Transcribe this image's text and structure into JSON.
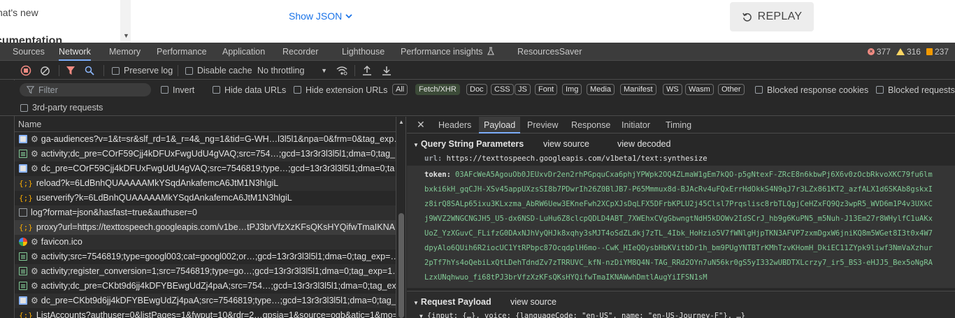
{
  "top": {
    "whats_new": "hat's new",
    "documentation": "cumentation",
    "show_json": "Show JSON",
    "replay": "REPLAY"
  },
  "devtools_tabs": [
    "Sources",
    "Network",
    "Memory",
    "Performance",
    "Application",
    "Recorder",
    "Lighthouse",
    "Performance insights",
    "ResourcesSaver"
  ],
  "issues": {
    "errors": "377",
    "warnings": "316",
    "info": "237"
  },
  "toolbar1": {
    "preserve_log": "Preserve log",
    "disable_cache": "Disable cache",
    "throttling": "No throttling"
  },
  "toolbar2": {
    "filter_placeholder": "Filter",
    "invert": "Invert",
    "hide_data_urls": "Hide data URLs",
    "hide_extension_urls": "Hide extension URLs",
    "type_chips": [
      "All",
      "Fetch/XHR",
      "Doc",
      "CSS",
      "JS",
      "Font",
      "Img",
      "Media",
      "Manifest",
      "WS",
      "Wasm",
      "Other"
    ],
    "selected_chip": "Fetch/XHR",
    "blocked_response_cookies": "Blocked response cookies",
    "blocked_requests": "Blocked requests"
  },
  "toolbar3": {
    "third_party": "3rd-party requests"
  },
  "list": {
    "header": "Name",
    "rows": [
      {
        "icon": "doc",
        "gear": true,
        "text": "ga-audiences?v=1&t=sr&slf_rd=1&_r=4&_ng=1&tid=G-WH…l3l5l1&npa=0&frm=0&tag_exp…"
      },
      {
        "icon": "script",
        "gear": true,
        "text": "activity;dc_pre=COrF59Cjj4kDFUxFwgUdU4gVAQ;src=754…;gcd=13r3r3l3l5l1;dma=0;tag_…"
      },
      {
        "icon": "doc",
        "gear": true,
        "text": "dc_pre=COrF59Cjj4kDFUxFwgUdU4gVAQ;src=7546819;type…;gcd=13r3r3l3l5l1;dma=0;ta…"
      },
      {
        "icon": "fetch",
        "gear": false,
        "text": "reload?k=6LdBnhQUAAAAAMkYSqdAnkafemcA6JtM1N3hlgiL"
      },
      {
        "icon": "fetch",
        "gear": false,
        "text": "userverify?k=6LdBnhQUAAAAAMkYSqdAnkafemcA6JtM1N3hlgiL"
      },
      {
        "icon": "other",
        "gear": false,
        "text": "log?format=json&hasfast=true&authuser=0"
      },
      {
        "icon": "fetch",
        "gear": false,
        "text": "proxy?url=https://texttospeech.googleapis.com/v1be…tPJ3brVfzXzKFsQKsHYQifwTmaIKNA…"
      },
      {
        "icon": "fav",
        "gear": true,
        "text": "favicon.ico"
      },
      {
        "icon": "script",
        "gear": true,
        "text": "activity;src=7546819;type=googl003;cat=googl002;or…;gcd=13r3r3l3l5l1;dma=0;tag_exp=…"
      },
      {
        "icon": "script",
        "gear": true,
        "text": "activity;register_conversion=1;src=7546819;type=go…;gcd=13r3r3l3l5l1;dma=0;tag_exp=1…"
      },
      {
        "icon": "script",
        "gear": true,
        "text": "activity;dc_pre=CKbt9d6jj4kDFYBEwgUdZj4paA;src=754…;gcd=13r3r3l3l5l1;dma=0;tag_ex…"
      },
      {
        "icon": "doc",
        "gear": true,
        "text": "dc_pre=CKbt9d6jj4kDFYBEwgUdZj4paA;src=7546819;type…;gcd=13r3r3l3l5l1;dma=0;tag_…"
      },
      {
        "icon": "fetch",
        "gear": false,
        "text": "ListAccounts?authuser=0&listPages=1&fwput=10&rdr=2…gpsia=1&source=ogb&atic=1&mo=…"
      }
    ],
    "selected_index": 6
  },
  "detail": {
    "tabs": [
      "Headers",
      "Payload",
      "Preview",
      "Response",
      "Initiator",
      "Timing"
    ],
    "active_tab": "Payload",
    "qsp_title": "Query String Parameters",
    "view_source": "view source",
    "view_decoded": "view decoded",
    "url_key": "url:",
    "url_value": "https://texttospeech.googleapis.com/v1beta1/text:synthesize",
    "token_key": "token:",
    "token_lines": [
      "03AFcWeA5AgouOb0JEUxvDr2en2rhPGpquCxa6phjYPWpk2OQ4ZLmaW1gEm7kQO-p5gNtexF-ZRcE8n6kbwPj6X6v0zOcbRkvoXKC79fu6lm",
      "bxki6kH_gqCJH-XSv45appUXzsSI8b7PDwrIh26Z0BlJB7-P65Mmmux8d-BJAcRv4uFQxErrHdOkkS4N9qJ7r3LZx861KT2_azfALX1d6SKAb8gskxI",
      "z8irQ8SALp65ixu3KLxzma_AbRW6Uew3EKneFwh2XCpXJsDqLFX5DFrbKPLU2j45Clsl7Prqslisc8rbTLQgjCeHZxFQ9Qz3wpR5_WVD6m1P4v3UXkC",
      "j9WVZ2WNGCNGJH5_U5-dx6NSD-LuHu6Z8clcpQDLD4ABT_7XWEhxCVgGbwngtNdH5kDOWv2IdSCrJ_hb9g6KuPN5_m5Nuh-J13Em27r8WHylfC1uAKx",
      "UoZ_YzXGuvC_FLifzG0DAxNJhVyQHJk8xqhy3sMJT4oSdZLdkj7zTL_4Ibk_HoHzio5V7fWNlgHjpTKN3AFVP7zxmDgxW6jniKQ8m5WGet8I3t0x4W7",
      "dpyAlo6QUih6R2iocUC1YtRPbpc87OcqdplH6mo--CwK_HIeQOysbHbKVitbDr1h_bm9PUgYNTBTrKMhTzvKHomH_DkiEC11ZYpk9liwf3NmVaXzhur",
      "2pTf7hYs4oQebiLxQtLDehTdndZv7zTRRUVC_kfN-nzDiYM8Q4N-TAG_RRd2OYn7uN56kr0gS5yI332wUBDTXLcrzy7_ir5_BS3-eHJJ5_Bex5oNgRA",
      "LzxUNqhwuo_fi68tPJ3brVfzXzKFsQKsHYQifwTmaIKNAWwhDmtlAugYiIFSN1sM"
    ],
    "request_payload_title": "Request Payload",
    "payload_line": "{input: {…}, voice: {languageCode: \"en-US\", name: \"en-US-Journey-F\"}, …}"
  }
}
